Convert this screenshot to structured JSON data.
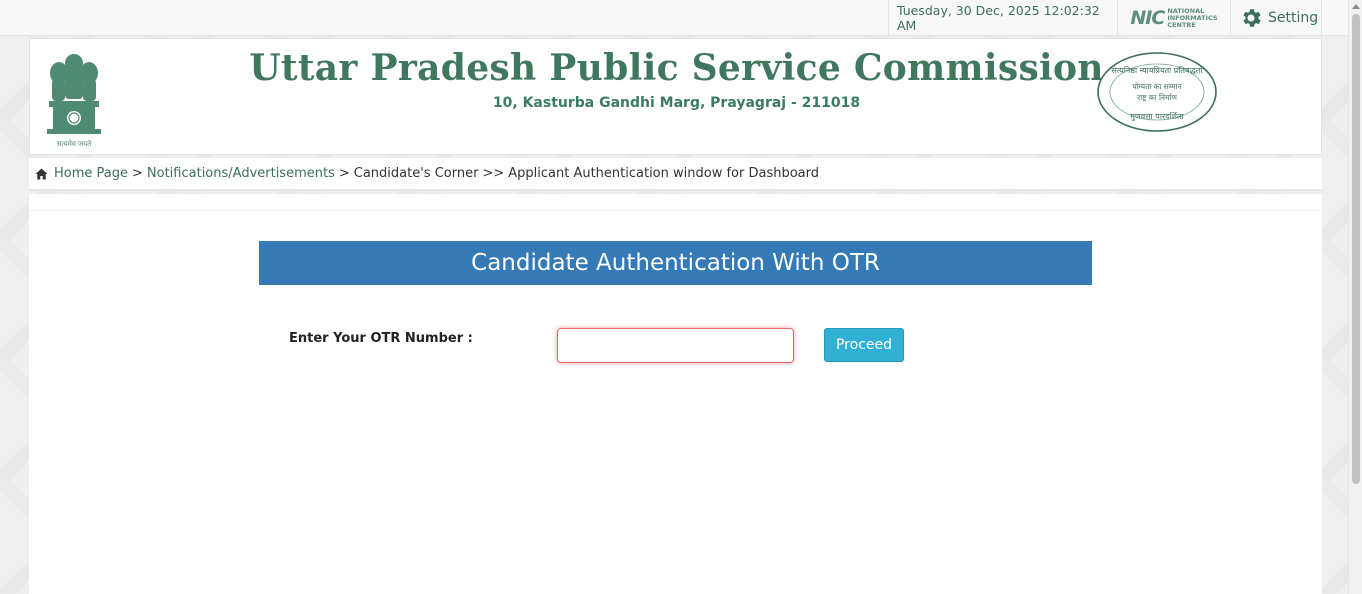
{
  "topbar": {
    "datetime": "Tuesday, 30 Dec, 2025 12:02:32 AM",
    "nic_logo_text": "NIC",
    "nic_logo_subtext": [
      "NATIONAL",
      "INFORMATICS",
      "CENTRE"
    ],
    "setting_label": "Setting",
    "setting_icon": "gear-icon"
  },
  "header": {
    "title": "Uttar Pradesh Public Service Commission",
    "address": "10, Kasturba Gandhi Marg, Prayagraj - 211018",
    "emblem_caption": "सत्यमेव जयते",
    "seal_text_top": "सत्यनिष्ठा न्यायप्रियता प्रतिबद्धता",
    "seal_text_mid1": "योग्यता का सम्मान",
    "seal_text_mid2": "राष्ट्र का निर्माण",
    "seal_text_bottom": "गुणवत्ता पारदर्शिता"
  },
  "breadcrumb": {
    "home_icon": "home-icon",
    "items": [
      "Home Page",
      "Notifications/Advertisements",
      "Candidate's Corner",
      "Applicant Authentication window for Dashboard"
    ],
    "separators": [
      ">",
      ">",
      ">>"
    ]
  },
  "form": {
    "heading": "Candidate Authentication With OTR",
    "otr_label": "Enter Your OTR Number :",
    "otr_value": "",
    "otr_placeholder": "",
    "proceed_label": "Proceed"
  },
  "colors": {
    "brand_green": "#40775f",
    "panel_blue": "#337ab7",
    "button_cyan": "#31b0d5",
    "error_red": "#e06a6a"
  }
}
